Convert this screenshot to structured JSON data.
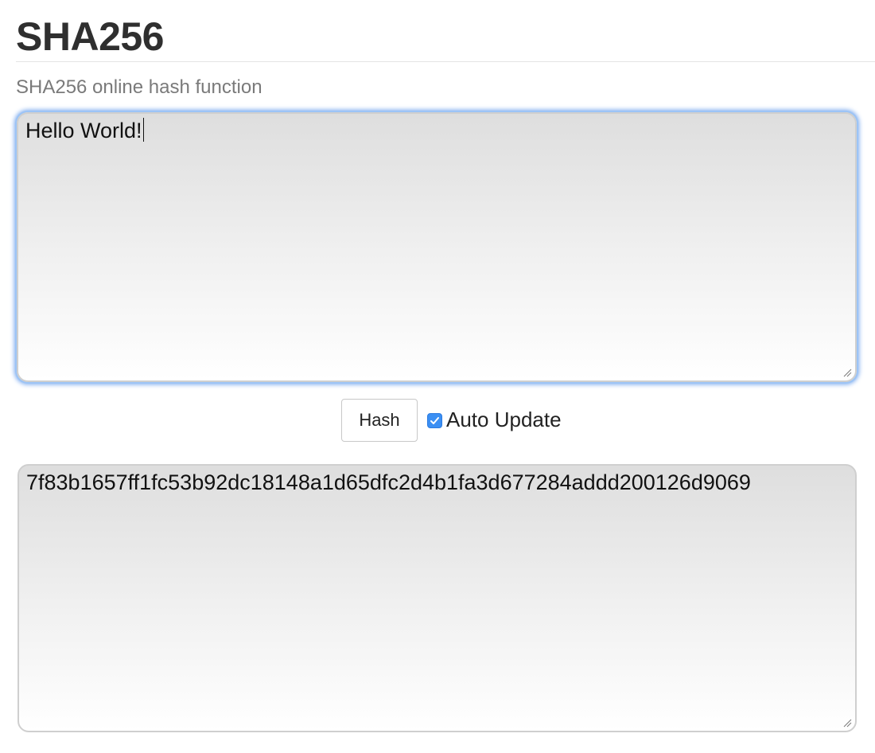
{
  "header": {
    "title": "SHA256",
    "subtitle": "SHA256 online hash function"
  },
  "input": {
    "value": "Hello World!"
  },
  "controls": {
    "hash_label": "Hash",
    "auto_update_label": "Auto Update",
    "auto_update_checked": true
  },
  "output": {
    "value": "7f83b1657ff1fc53b92dc18148a1d65dfc2d4b1fa3d677284addd200126d9069"
  },
  "colors": {
    "focus_ring": "#7aa9ee",
    "checkbox_accent": "#3b8ff3"
  }
}
